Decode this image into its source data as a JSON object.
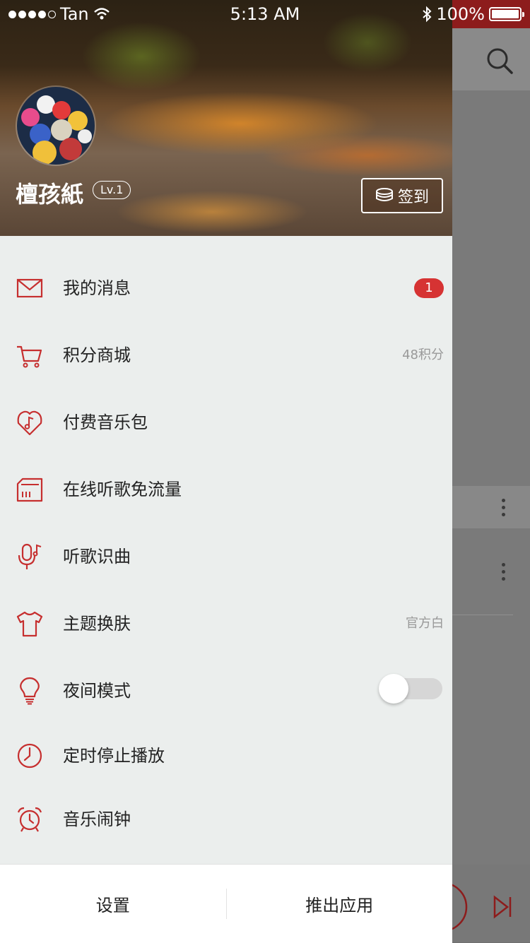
{
  "status_bar": {
    "carrier": "Tan",
    "time": "5:13 AM",
    "battery": "100%"
  },
  "profile": {
    "username": "檀孩紙",
    "level": "Lv.1",
    "checkin_label": "签到"
  },
  "menu": {
    "items": [
      {
        "label": "我的消息",
        "icon": "mail-icon",
        "badge": "1"
      },
      {
        "label": "积分商城",
        "icon": "cart-icon",
        "extra": "48积分"
      },
      {
        "label": "付费音乐包",
        "icon": "music-shield-icon"
      },
      {
        "label": "在线听歌免流量",
        "icon": "sim-card-icon"
      },
      {
        "label": "听歌识曲",
        "icon": "microphone-note-icon"
      },
      {
        "label": "主题换肤",
        "icon": "tshirt-icon",
        "extra": "官方白"
      },
      {
        "label": "夜间模式",
        "icon": "lightbulb-icon",
        "toggle": false
      },
      {
        "label": "定时停止播放",
        "icon": "clock-icon"
      },
      {
        "label": "音乐闹钟",
        "icon": "alarm-clock-icon"
      }
    ]
  },
  "footer": {
    "settings_label": "设置",
    "exit_label": "推出应用"
  },
  "colors": {
    "accent": "#c62f2f",
    "badge": "#d63333",
    "drawer_bg": "#ebeeed"
  }
}
